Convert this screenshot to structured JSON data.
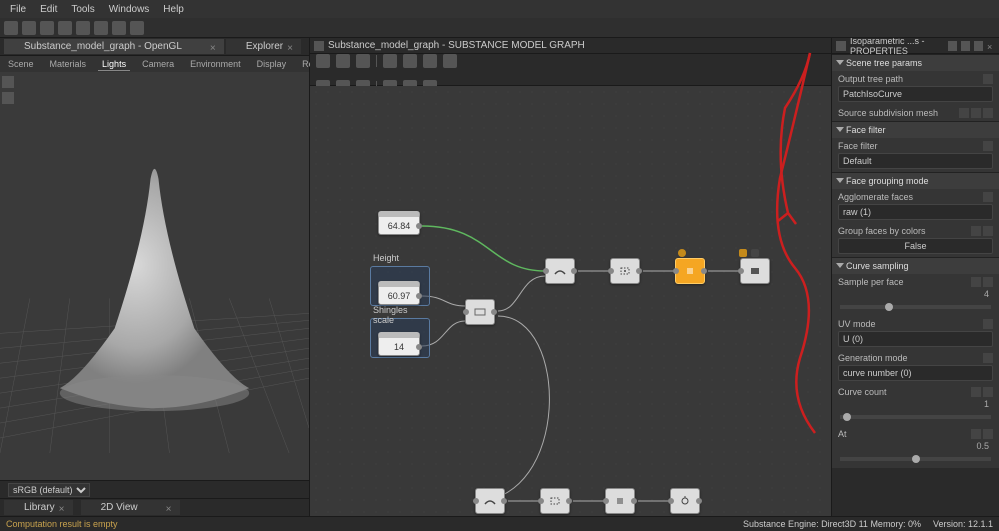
{
  "menu": {
    "file": "File",
    "edit": "Edit",
    "tools": "Tools",
    "windows": "Windows",
    "help": "Help"
  },
  "left_tabs": {
    "main": "Substance_model_graph - OpenGL",
    "explorer": "Explorer"
  },
  "subtabs": {
    "scene": "Scene",
    "materials": "Materials",
    "lights": "Lights",
    "camera": "Camera",
    "environment": "Environment",
    "display": "Display",
    "renderer": "Renderer"
  },
  "colorspace": "sRGB (default)",
  "lib": {
    "library": "Library",
    "view2d": "2D View"
  },
  "graph": {
    "title": "Substance_model_graph - SUBSTANCE MODEL GRAPH"
  },
  "nodes": {
    "float1": "64.84",
    "float2": "60.97",
    "float3": "14",
    "group_height": "Height",
    "group_shingles": "Shingles scale"
  },
  "props": {
    "title": "Isoparametric ...s - PROPERTIES",
    "scene_tree": "Scene tree params",
    "output_tree_path": "Output tree path",
    "output_tree_path_val": "PatchIsoCurve",
    "source_subdiv": "Source subdivision mesh",
    "face_filter": "Face filter",
    "face_filter_lbl": "Face filter",
    "face_filter_val": "Default",
    "face_grouping": "Face grouping mode",
    "agglomerate": "Agglomerate faces",
    "agglomerate_val": "raw (1)",
    "group_by_colors": "Group faces by colors",
    "group_by_colors_val": "False",
    "curve_sampling": "Curve sampling",
    "sample_per_face": "Sample per face",
    "sample_per_face_val": "4",
    "uv_mode": "UV mode",
    "uv_mode_val": "U (0)",
    "gen_mode": "Generation mode",
    "gen_mode_val": "curve number (0)",
    "curve_count": "Curve count",
    "curve_count_val": "1",
    "at": "At",
    "at_val": "0.5"
  },
  "status": {
    "warn": "Computation result is empty",
    "engine": "Substance Engine: Direct3D 11  Memory: 0%",
    "version": "Version: 12.1.1"
  }
}
